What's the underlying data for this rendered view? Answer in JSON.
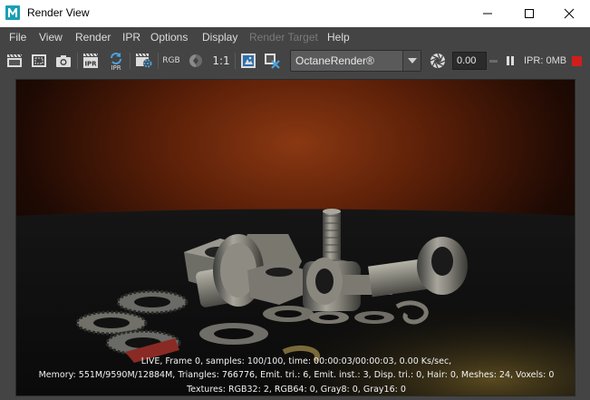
{
  "window": {
    "title": "Render View",
    "app_icon": "maya-logo-icon",
    "controls": [
      "minimize-icon",
      "maximize-icon",
      "close-icon"
    ]
  },
  "menu": {
    "items": [
      {
        "label": "File",
        "enabled": true
      },
      {
        "label": "View",
        "enabled": true
      },
      {
        "label": "Render",
        "enabled": true
      },
      {
        "label": "IPR",
        "enabled": true
      },
      {
        "label": "Options",
        "enabled": true
      },
      {
        "label": "Display",
        "enabled": true
      },
      {
        "label": "Render Target",
        "enabled": false
      },
      {
        "label": "Help",
        "enabled": true
      }
    ]
  },
  "toolbar": {
    "icons": [
      "redo-render-icon",
      "render-region-icon",
      "snapshot-icon",
      "ipr-render-icon",
      "refresh-ipr-icon",
      "render-settings-icon",
      "rgb-channels-icon",
      "exposure-icon",
      "one-to-one-icon",
      "keep-image-icon",
      "remove-image-icon"
    ],
    "ipr_label": "IPR",
    "rgb_label": "RGB",
    "zoom_label": "1:1",
    "renderer": "OctaneRender®",
    "value": "0.00",
    "ipr_status": "IPR: 0MB",
    "accent_color": "#d01e1e"
  },
  "render": {
    "stats_line1": "LIVE, Frame 0, samples: 100/100, time: 00:00:03/00:00:03, 0.00 Ks/sec,",
    "stats_line2": "Memory: 551M/9590M/12884M, Triangles: 766776, Emit. tri.: 6, Emit. inst.: 3, Disp. tri.: 0, Hair: 0, Meshes: 24, Voxels: 0",
    "stats_line3": "Textures: RGB32: 2, RGB64: 0, Gray8: 0, Gray16: 0",
    "image": "render-image-bolts-nuts-washers"
  }
}
